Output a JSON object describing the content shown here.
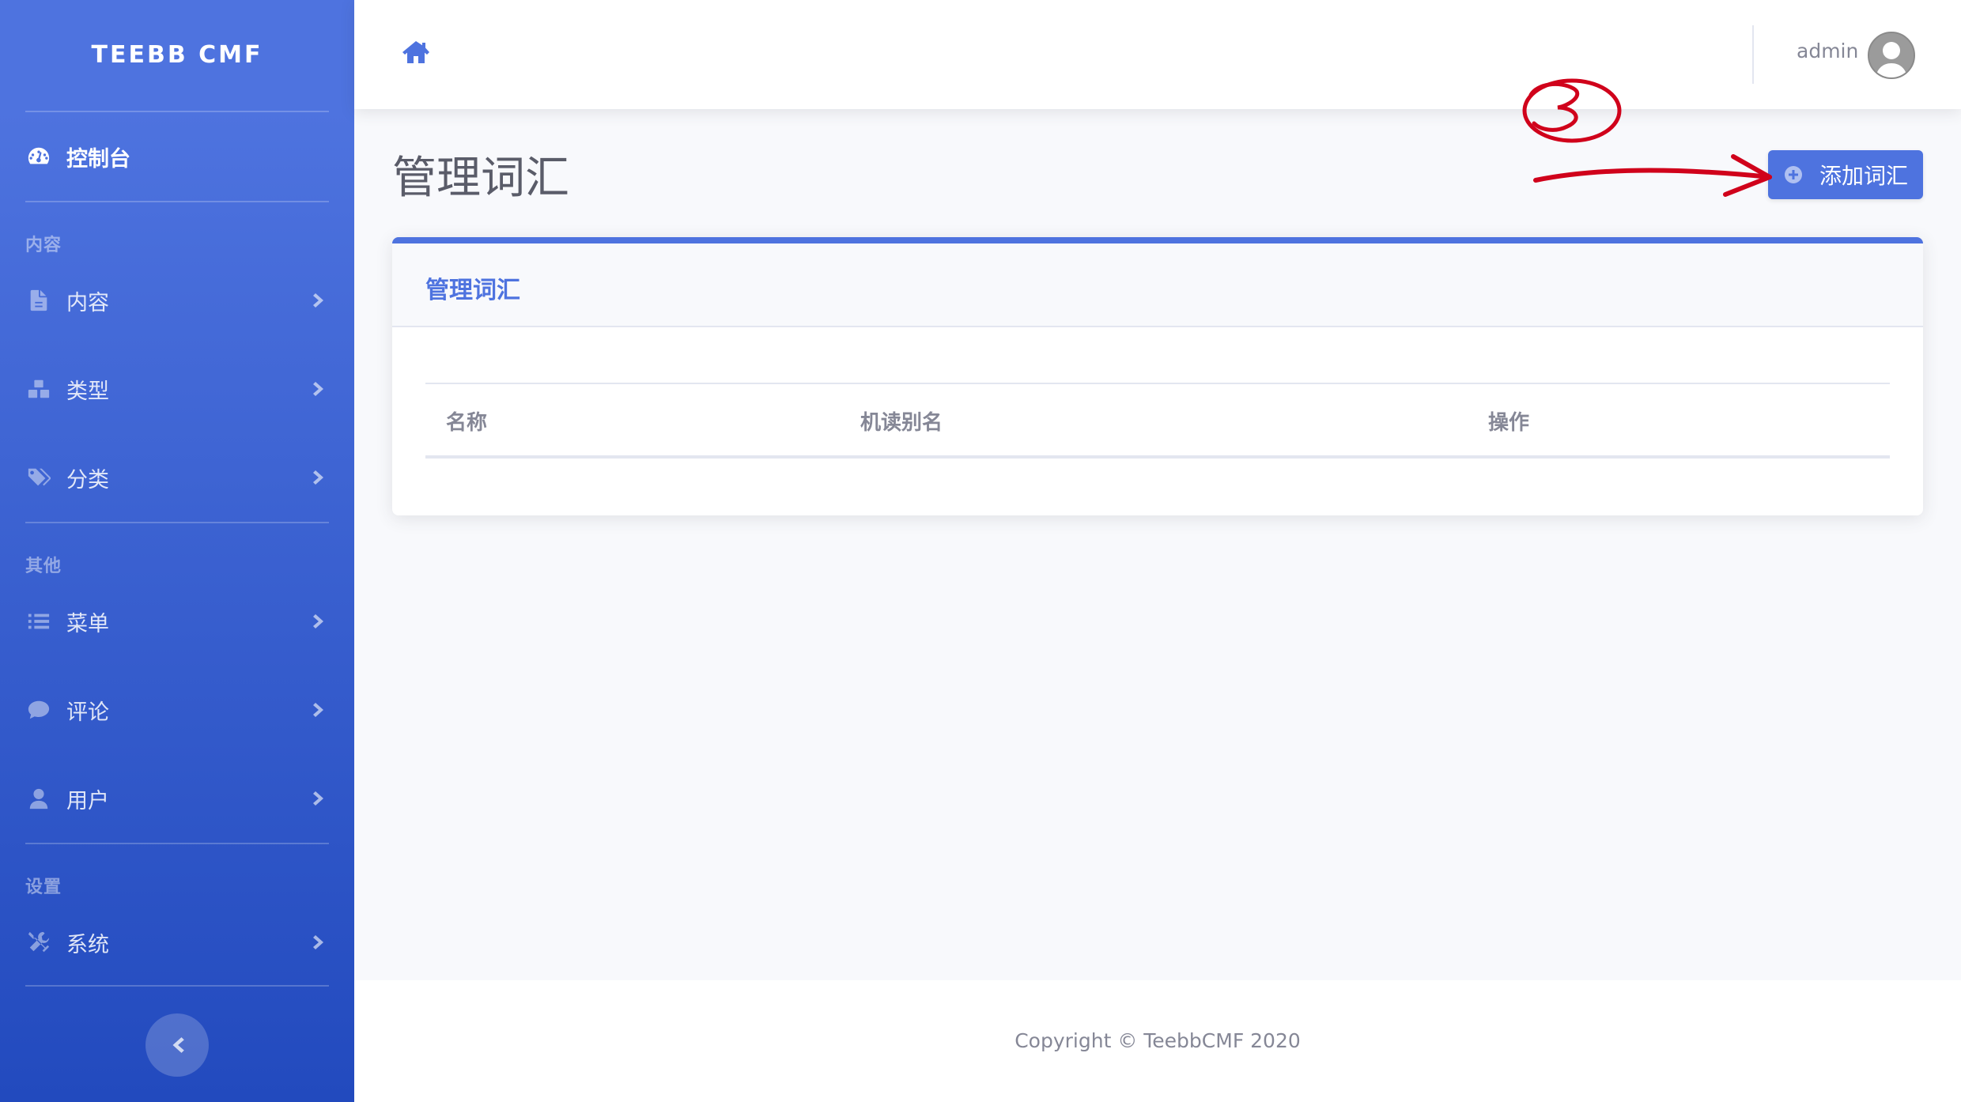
{
  "sidebar": {
    "brand": "TEEBB CMF",
    "dashboard": {
      "label": "控制台",
      "icon": "tachometer-icon"
    },
    "sections": [
      {
        "heading": "内容",
        "items": [
          {
            "label": "内容",
            "icon": "file-icon"
          },
          {
            "label": "类型",
            "icon": "cubes-icon"
          },
          {
            "label": "分类",
            "icon": "tags-icon"
          }
        ]
      },
      {
        "heading": "其他",
        "items": [
          {
            "label": "菜单",
            "icon": "list-icon"
          },
          {
            "label": "评论",
            "icon": "comment-icon"
          },
          {
            "label": "用户",
            "icon": "user-icon"
          }
        ]
      },
      {
        "heading": "设置",
        "items": [
          {
            "label": "系统",
            "icon": "tools-icon"
          }
        ]
      }
    ],
    "toggle_icon": "chevron-left-icon"
  },
  "topbar": {
    "home_icon": "home-icon",
    "user_name": "admin",
    "avatar_icon": "user-avatar-icon"
  },
  "page": {
    "title": "管理词汇",
    "add_button_label": "添加词汇",
    "add_button_icon": "plus-circle-icon"
  },
  "card": {
    "title": "管理词汇",
    "table": {
      "columns": [
        "名称",
        "机读别名",
        "操作"
      ],
      "rows": []
    }
  },
  "footer": {
    "copyright": "Copyright © TeebbCMF 2020"
  },
  "colors": {
    "primary": "#4e73df",
    "sidebar_gradient_end": "#224abe",
    "annotation": "#d0021b"
  }
}
